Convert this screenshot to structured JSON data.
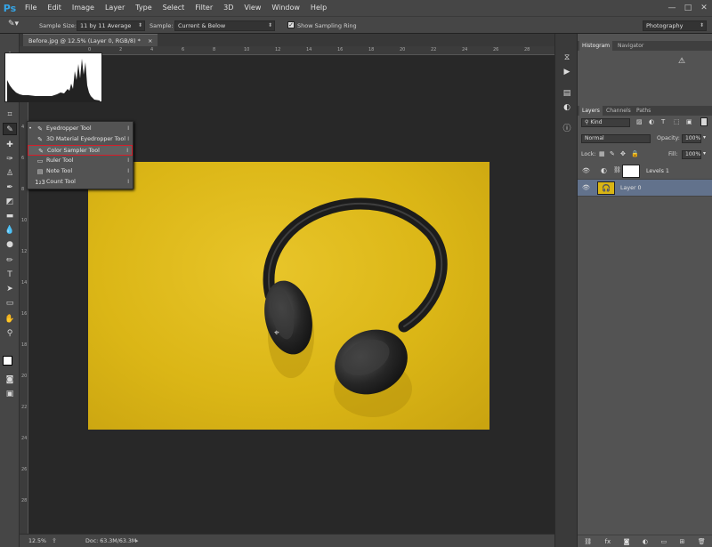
{
  "app": {
    "logo": "Ps",
    "menu": [
      "File",
      "Edit",
      "Image",
      "Layer",
      "Type",
      "Select",
      "Filter",
      "3D",
      "View",
      "Window",
      "Help"
    ],
    "window_buttons": [
      "—",
      "□",
      "✕"
    ]
  },
  "options": {
    "sample_size_label": "Sample Size:",
    "sample_size_value": "11 by 11 Average",
    "sample_label": "Sample:",
    "sample_value": "Current & Below",
    "show_ring_label": "Show Sampling Ring",
    "workspace": "Photography"
  },
  "document": {
    "tab_title": "Before.jpg @ 12.5% (Layer 0, RGB/8) *",
    "close": "×"
  },
  "flyout": {
    "items": [
      {
        "label": "Eyedropper Tool",
        "key": "I",
        "icon": "eyedropper-icon",
        "glyph": "✎",
        "current": true
      },
      {
        "label": "3D Material Eyedropper Tool",
        "key": "I",
        "icon": "3d-eyedropper-icon",
        "glyph": "✎",
        "current": false
      },
      {
        "label": "Color Sampler Tool",
        "key": "I",
        "icon": "color-sampler-icon",
        "glyph": "✎",
        "current": false
      },
      {
        "label": "Ruler Tool",
        "key": "I",
        "icon": "ruler-icon",
        "glyph": "▭",
        "current": false
      },
      {
        "label": "Note Tool",
        "key": "I",
        "icon": "note-icon",
        "glyph": "▤",
        "current": false
      },
      {
        "label": "Count Tool",
        "key": "I",
        "icon": "count-icon",
        "glyph": "1₂3",
        "current": false
      }
    ],
    "highlight_color": "#d41e2a"
  },
  "status": {
    "zoom": "12.5%",
    "doc": "Doc: 63.3M/63.3M"
  },
  "histogram_panel": {
    "tabs": [
      "Histogram",
      "Navigator"
    ]
  },
  "layers_panel": {
    "tabs": [
      "Layers",
      "Channels",
      "Paths"
    ],
    "filter": "Kind",
    "blend_mode": "Normal",
    "opacity_label": "Opacity:",
    "opacity": "100%",
    "lock_label": "Lock:",
    "fill_label": "Fill:",
    "fill": "100%",
    "layers": [
      {
        "name": "Levels 1",
        "type": "adjustment",
        "selected": false
      },
      {
        "name": "Layer 0",
        "type": "image",
        "selected": true
      }
    ]
  },
  "rulers": {
    "h_ticks": [
      "0",
      "2",
      "4",
      "6",
      "8",
      "10",
      "12",
      "14",
      "16",
      "18",
      "20",
      "22",
      "24",
      "26",
      "28"
    ],
    "v_ticks": [
      "0",
      "2",
      "4",
      "6",
      "8",
      "10",
      "12",
      "14",
      "16",
      "18",
      "20",
      "22",
      "24",
      "26",
      "28"
    ]
  },
  "colors": {
    "accent": "#35a6e8",
    "canvas_bg": "#282828",
    "image_yellow": "#dbb616",
    "selected_layer": "#62728c"
  }
}
